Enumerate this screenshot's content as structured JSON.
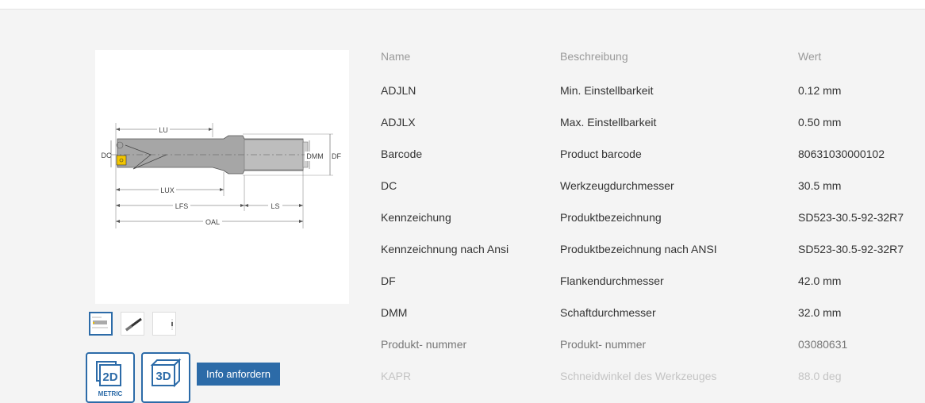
{
  "image": {
    "labels": {
      "lu": "LU",
      "dc": "DC",
      "dmm": "DMM",
      "df": "DF",
      "lux": "LUX",
      "lfs": "LFS",
      "ls": "LS",
      "oal": "OAL"
    }
  },
  "cad": {
    "btn2d_label": "2D",
    "btn2d_sub": "METRIC",
    "btn3d_label": "3D"
  },
  "info_button": "Info anfordern",
  "table": {
    "headers": {
      "name": "Name",
      "desc": "Beschreibung",
      "value": "Wert"
    },
    "rows": [
      {
        "name": "ADJLN",
        "desc": "Min. Einstellbarkeit",
        "value": "0.12 mm"
      },
      {
        "name": "ADJLX",
        "desc": "Max. Einstellbarkeit",
        "value": "0.50 mm"
      },
      {
        "name": "Barcode",
        "desc": "Product barcode",
        "value": "80631030000102"
      },
      {
        "name": "DC",
        "desc": "Werkzeugdurchmesser",
        "value": "30.5 mm"
      },
      {
        "name": "Kennzeichung",
        "desc": "Produktbezeichnung",
        "value": "SD523-30.5-92-32R7"
      },
      {
        "name": "Kennzeichnung nach Ansi",
        "desc": "Produktbezeichnung nach ANSI",
        "value": "SD523-30.5-92-32R7"
      },
      {
        "name": "DF",
        "desc": "Flankendurchmesser",
        "value": "42.0 mm"
      },
      {
        "name": "DMM",
        "desc": "Schaftdurchmesser",
        "value": "32.0 mm"
      },
      {
        "name": "Produkt- nummer",
        "desc": "Produkt- nummer",
        "value": "03080631"
      },
      {
        "name": "KAPR",
        "desc": "Schneidwinkel des Werkzeuges",
        "value": "88.0 deg"
      }
    ]
  },
  "colors": {
    "accent": "#2c6ba8",
    "background": "#f4f4f4",
    "insert": "#f2c500"
  }
}
